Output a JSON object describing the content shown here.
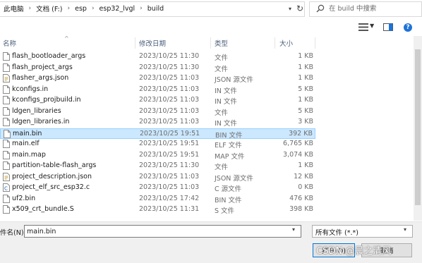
{
  "address": {
    "crumbs": [
      "此电脑",
      "文档 (F:)",
      "esp",
      "esp32_lvgl",
      "build"
    ],
    "search_placeholder": "在 build 中搜索"
  },
  "columns": {
    "name": "名称",
    "date": "修改日期",
    "type": "类型",
    "size": "大小"
  },
  "files": [
    {
      "name": "flash_bootloader_args",
      "date": "2023/10/25 11:30",
      "type": "文件",
      "size": "1 KB",
      "icon": "file-icon"
    },
    {
      "name": "flash_project_args",
      "date": "2023/10/25 11:30",
      "type": "文件",
      "size": "1 KB",
      "icon": "file-icon"
    },
    {
      "name": "flasher_args.json",
      "date": "2023/10/25 11:03",
      "type": "JSON 源文件",
      "size": "1 KB",
      "icon": "source-file-icon"
    },
    {
      "name": "kconfigs.in",
      "date": "2023/10/25 11:03",
      "type": "IN 文件",
      "size": "5 KB",
      "icon": "file-icon"
    },
    {
      "name": "kconfigs_projbuild.in",
      "date": "2023/10/25 11:03",
      "type": "IN 文件",
      "size": "1 KB",
      "icon": "file-icon"
    },
    {
      "name": "ldgen_libraries",
      "date": "2023/10/25 11:03",
      "type": "文件",
      "size": "5 KB",
      "icon": "file-icon"
    },
    {
      "name": "ldgen_libraries.in",
      "date": "2023/10/25 11:03",
      "type": "IN 文件",
      "size": "3 KB",
      "icon": "file-icon"
    },
    {
      "name": "main.bin",
      "date": "2023/10/25 19:51",
      "type": "BIN 文件",
      "size": "392 KB",
      "icon": "file-icon",
      "selected": true
    },
    {
      "name": "main.elf",
      "date": "2023/10/25 19:51",
      "type": "ELF 文件",
      "size": "6,765 KB",
      "icon": "file-icon"
    },
    {
      "name": "main.map",
      "date": "2023/10/25 19:51",
      "type": "MAP 文件",
      "size": "3,074 KB",
      "icon": "file-icon"
    },
    {
      "name": "partition-table-flash_args",
      "date": "2023/10/25 11:30",
      "type": "文件",
      "size": "1 KB",
      "icon": "file-icon"
    },
    {
      "name": "project_description.json",
      "date": "2023/10/25 11:03",
      "type": "JSON 源文件",
      "size": "12 KB",
      "icon": "source-file-icon"
    },
    {
      "name": "project_elf_src_esp32.c",
      "date": "2023/10/25 11:03",
      "type": "C 源文件",
      "size": "0 KB",
      "icon": "c-file-icon"
    },
    {
      "name": "uf2.bin",
      "date": "2023/10/25 17:42",
      "type": "BIN 文件",
      "size": "476 KB",
      "icon": "file-icon"
    },
    {
      "name": "x509_crt_bundle.S",
      "date": "2023/10/25 11:31",
      "type": "S 文件",
      "size": "398 KB",
      "icon": "file-icon"
    }
  ],
  "bottom": {
    "filename_label": "件名(N):",
    "filename_value": "main.bin",
    "filter_value": "所有文件 (*.*)",
    "open_label": "打开(O)",
    "cancel_label": "取消",
    "watermark": "CSDN @晨之清风"
  },
  "colors": {
    "selection_bg": "#cce8ff",
    "selection_border": "#99d1ff",
    "accent": "#0078d7"
  }
}
